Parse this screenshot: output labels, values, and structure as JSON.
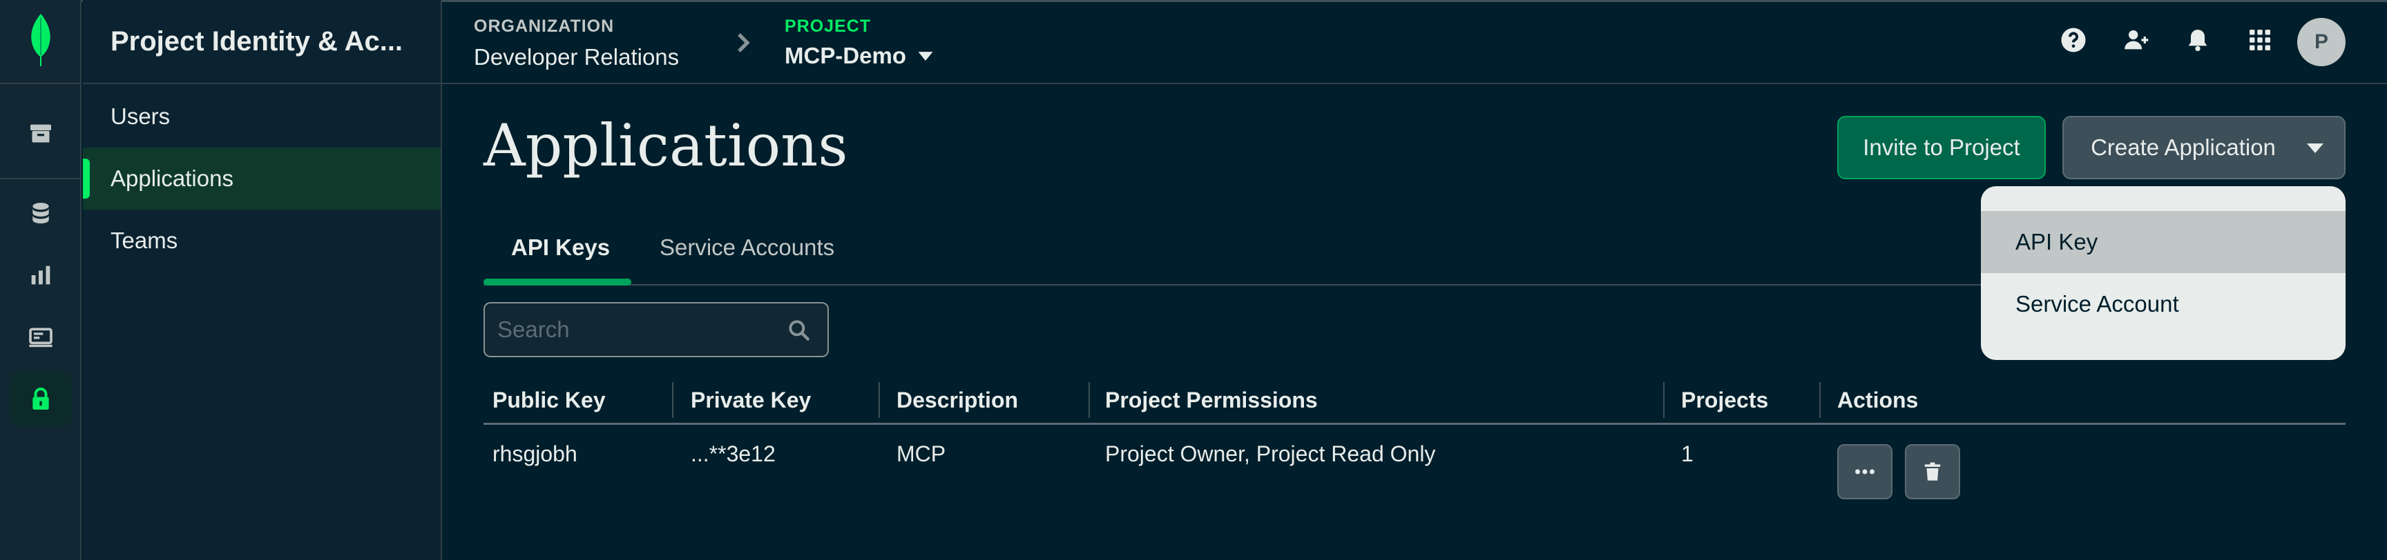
{
  "app": {
    "title": "Project Identity & Ac...",
    "colors": {
      "brand_green": "#00ED64",
      "bg": "#001E2B",
      "primary_btn": "#00684A"
    }
  },
  "rail": {
    "icons": [
      "leaf-logo-icon",
      "archive-icon",
      "database-icon",
      "bar-chart-icon",
      "monitor-icon",
      "lock-icon"
    ]
  },
  "leftnav": {
    "items": [
      {
        "label": "Users"
      },
      {
        "label": "Applications",
        "active": true
      },
      {
        "label": "Teams"
      }
    ]
  },
  "topbar": {
    "org_label": "ORGANIZATION",
    "org_value": "Developer Relations",
    "project_label": "PROJECT",
    "project_value": "MCP-Demo",
    "avatar_initial": "P",
    "icons": [
      "help-icon",
      "add-user-icon",
      "bell-icon",
      "apps-grid-icon"
    ]
  },
  "main": {
    "title": "Applications",
    "invite_label": "Invite to Project",
    "create_label": "Create Application",
    "tabs": [
      {
        "label": "API Keys",
        "active": true
      },
      {
        "label": "Service Accounts"
      }
    ],
    "search_placeholder": "Search",
    "table": {
      "headers": [
        "Public Key",
        "Private Key",
        "Description",
        "Project Permissions",
        "Projects",
        "Actions"
      ],
      "rows": [
        {
          "public_key": "rhsgjobh",
          "private_key": "...**3e12",
          "description": "MCP",
          "permissions": "Project Owner, Project Read Only",
          "projects": "1"
        }
      ]
    }
  },
  "create_menu": {
    "items": [
      {
        "label": "API Key",
        "hover": true
      },
      {
        "label": "Service Account"
      }
    ]
  }
}
